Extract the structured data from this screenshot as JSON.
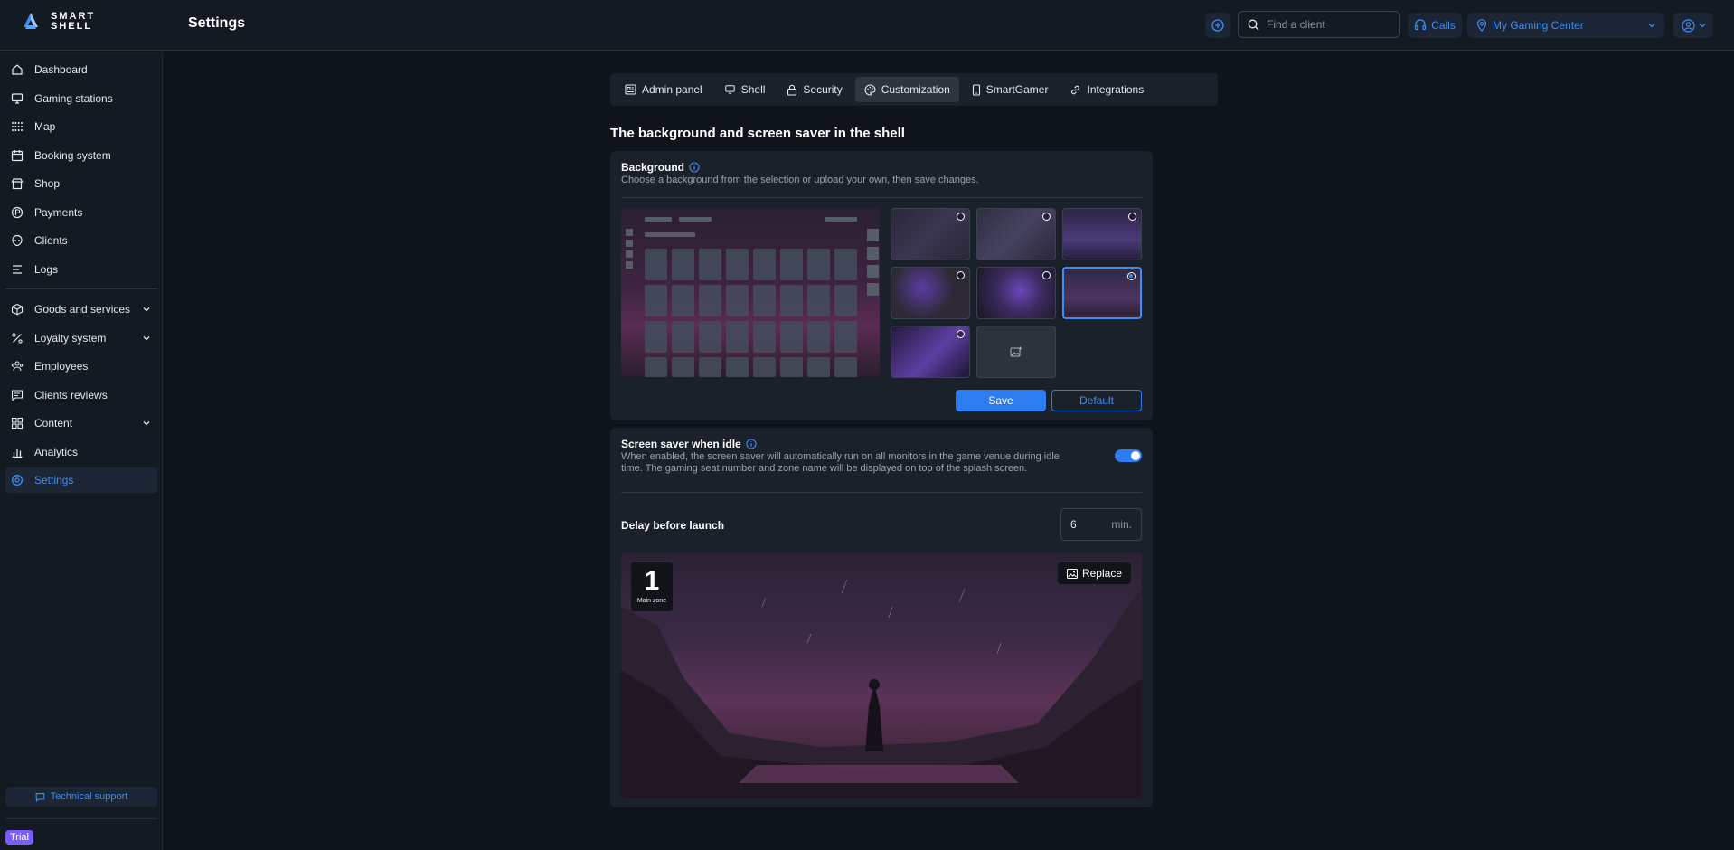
{
  "app": {
    "logo_text_1": "SMART",
    "logo_text_2": "SHELL",
    "page_title": "Settings"
  },
  "topbar": {
    "search_placeholder": "Find a client",
    "calls_label": "Calls",
    "center_label": "My Gaming Center"
  },
  "sidebar": {
    "items": [
      {
        "label": "Dashboard",
        "icon": "home-icon"
      },
      {
        "label": "Gaming stations",
        "icon": "monitor-icon"
      },
      {
        "label": "Map",
        "icon": "grid-dots-icon"
      },
      {
        "label": "Booking system",
        "icon": "calendar-icon"
      },
      {
        "label": "Shop",
        "icon": "store-icon"
      },
      {
        "label": "Payments",
        "icon": "coin-icon"
      },
      {
        "label": "Clients",
        "icon": "alien-icon"
      },
      {
        "label": "Logs",
        "icon": "list-icon"
      },
      {
        "label": "Goods and services",
        "icon": "box-icon"
      },
      {
        "label": "Loyalty system",
        "icon": "percent-icon"
      },
      {
        "label": "Employees",
        "icon": "users-icon"
      },
      {
        "label": "Clients reviews",
        "icon": "chat-icon"
      },
      {
        "label": "Content",
        "icon": "apps-icon"
      },
      {
        "label": "Analytics",
        "icon": "chart-icon"
      },
      {
        "label": "Settings",
        "icon": "gear-icon"
      }
    ],
    "support_label": "Technical support",
    "trial_label": "Trial"
  },
  "tabs": [
    {
      "label": "Admin panel"
    },
    {
      "label": "Shell"
    },
    {
      "label": "Security"
    },
    {
      "label": "Customization"
    },
    {
      "label": "SmartGamer"
    },
    {
      "label": "Integrations"
    }
  ],
  "main": {
    "section_title": "The background and screen saver in the shell",
    "background": {
      "title": "Background",
      "description": "Choose a background from the selection or upload your own, then save changes.",
      "save_label": "Save",
      "default_label": "Default",
      "selected_index": 5
    },
    "screensaver": {
      "title": "Screen saver when idle",
      "description_1": "When enabled, the screen saver will automatically run on all monitors in the game venue during idle",
      "description_2": "time. The gaming seat number and zone name will be displayed on top of the splash screen.",
      "enabled": true,
      "delay_label": "Delay before launch",
      "delay_value": "6",
      "delay_unit": "min.",
      "seat_number": "1",
      "zone_name": "Main zone",
      "replace_label": "Replace"
    }
  },
  "colors": {
    "accent": "#2d7df0",
    "background": "#0f141b",
    "panel": "#1b212a",
    "trial": "#7b5cff"
  }
}
